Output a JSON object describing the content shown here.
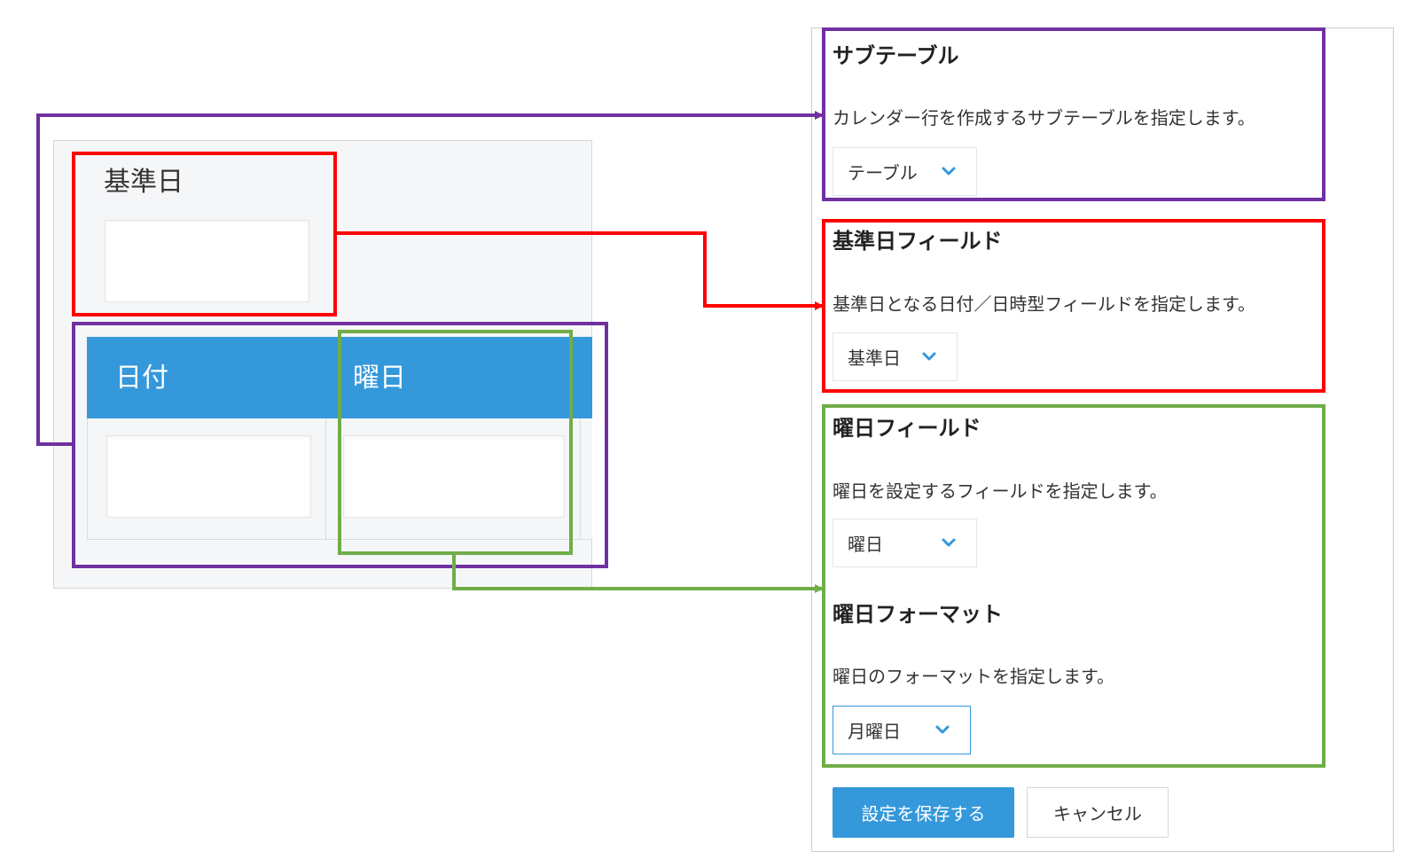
{
  "form_preview": {
    "base_date_label": "基準日",
    "table_headers": [
      "日付",
      "曜日"
    ]
  },
  "settings": {
    "subtable": {
      "title": "サブテーブル",
      "description": "カレンダー行を作成するサブテーブルを指定します。",
      "selected": "テーブル"
    },
    "base_date_field": {
      "title": "基準日フィールド",
      "description": "基準日となる日付／日時型フィールドを指定します。",
      "selected": "基準日"
    },
    "weekday_field": {
      "title": "曜日フィールド",
      "description": "曜日を設定するフィールドを指定します。",
      "selected": "曜日"
    },
    "weekday_format": {
      "title": "曜日フォーマット",
      "description": "曜日のフォーマットを指定します。",
      "selected": "月曜日"
    },
    "save_label": "設定を保存する",
    "cancel_label": "キャンセル"
  },
  "colors": {
    "accent": "#3498db",
    "highlight_subtable": "#7030a0",
    "highlight_base_date": "#ff0000",
    "highlight_weekday": "#70ad47"
  }
}
